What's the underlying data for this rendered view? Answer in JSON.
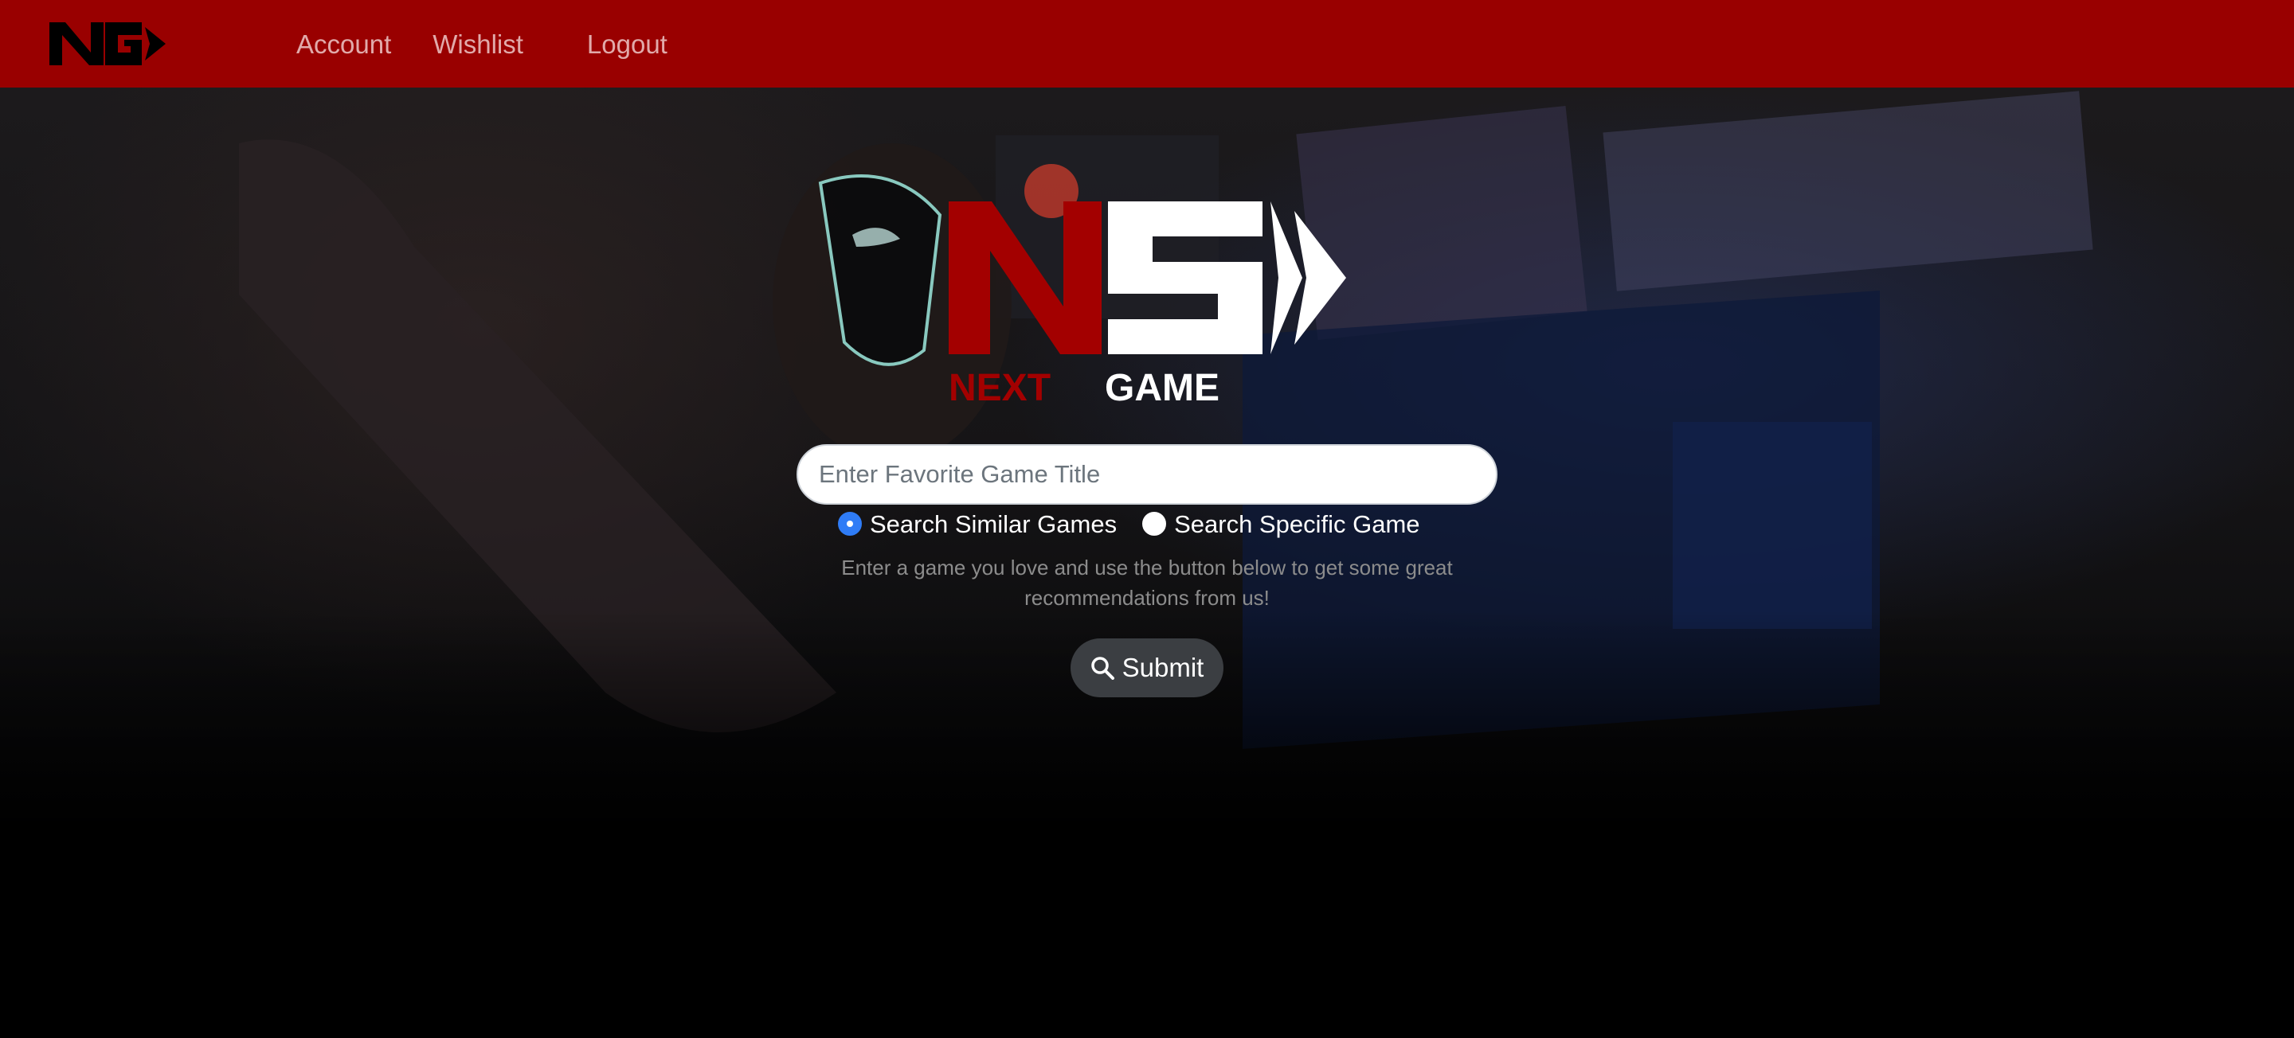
{
  "nav": {
    "logo_icon": "ng-logo-icon",
    "links": [
      "Account",
      "Wishlist",
      "Logout"
    ]
  },
  "brand": {
    "logo_icon": "next-game-logo-icon",
    "name_part1": "NEXT",
    "name_part2": "GAME"
  },
  "search": {
    "placeholder": "Enter Favorite Game Title",
    "value": ""
  },
  "options": [
    {
      "label": "Search Similar Games",
      "checked": true
    },
    {
      "label": "Search Specific Game",
      "checked": false
    }
  ],
  "helper_text": "Enter a game you love and use the button below to get some great recommendations from us!",
  "submit": {
    "label": "Submit",
    "icon": "search-icon"
  },
  "colors": {
    "nav_bg": "#990000",
    "brand_red": "#a30000",
    "radio_accent": "#2f7cf6",
    "button_bg": "#3b3e42"
  }
}
